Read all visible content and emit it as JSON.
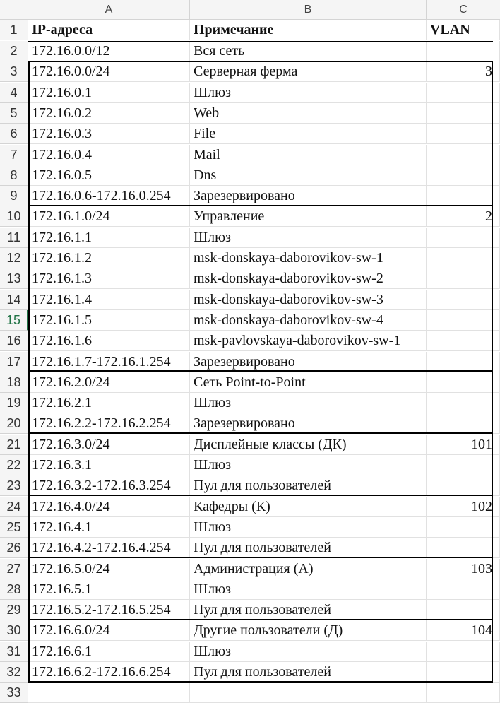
{
  "columns": [
    "A",
    "B",
    "C"
  ],
  "header": {
    "a": "IP-адреса",
    "b": "Примечание",
    "c": "VLAN"
  },
  "rows": [
    {
      "n": "2",
      "a": "172.16.0.0/12",
      "b": "Вся сеть",
      "c": ""
    },
    {
      "n": "3",
      "a": "172.16.0.0/24",
      "b": "Серверная ферма",
      "c": "3"
    },
    {
      "n": "4",
      "a": "172.16.0.1",
      "b": "Шлюз",
      "c": ""
    },
    {
      "n": "5",
      "a": "172.16.0.2",
      "b": "Web",
      "c": ""
    },
    {
      "n": "6",
      "a": "172.16.0.3",
      "b": "File",
      "c": ""
    },
    {
      "n": "7",
      "a": "172.16.0.4",
      "b": "Mail",
      "c": ""
    },
    {
      "n": "8",
      "a": "172.16.0.5",
      "b": "Dns",
      "c": ""
    },
    {
      "n": "9",
      "a": "172.16.0.6-172.16.0.254",
      "b": "Зарезервировано",
      "c": ""
    },
    {
      "n": "10",
      "a": "172.16.1.0/24",
      "b": "Управление",
      "c": "2"
    },
    {
      "n": "11",
      "a": "172.16.1.1",
      "b": "Шлюз",
      "c": ""
    },
    {
      "n": "12",
      "a": "172.16.1.2",
      "b": "msk-donskaya-daborovikov-sw-1",
      "c": ""
    },
    {
      "n": "13",
      "a": "172.16.1.3",
      "b": "msk-donskaya-daborovikov-sw-2",
      "c": ""
    },
    {
      "n": "14",
      "a": "172.16.1.4",
      "b": "msk-donskaya-daborovikov-sw-3",
      "c": ""
    },
    {
      "n": "15",
      "a": "172.16.1.5",
      "b": "msk-donskaya-daborovikov-sw-4",
      "c": ""
    },
    {
      "n": "16",
      "a": "172.16.1.6",
      "b": "msk-pavlovskaya-daborovikov-sw-1",
      "c": ""
    },
    {
      "n": "17",
      "a": "172.16.1.7-172.16.1.254",
      "b": "Зарезервировано",
      "c": ""
    },
    {
      "n": "18",
      "a": "172.16.2.0/24",
      "b": "Сеть Point-to-Point",
      "c": ""
    },
    {
      "n": "19",
      "a": "172.16.2.1",
      "b": "Шлюз",
      "c": ""
    },
    {
      "n": "20",
      "a": "172.16.2.2-172.16.2.254",
      "b": "Зарезервировано",
      "c": ""
    },
    {
      "n": "21",
      "a": "172.16.3.0/24",
      "b": "Дисплейные классы (ДК)",
      "c": "101"
    },
    {
      "n": "22",
      "a": "172.16.3.1",
      "b": "Шлюз",
      "c": ""
    },
    {
      "n": "23",
      "a": "172.16.3.2-172.16.3.254",
      "b": "Пул для пользователей",
      "c": ""
    },
    {
      "n": "24",
      "a": "172.16.4.0/24",
      "b": "Кафедры (К)",
      "c": "102"
    },
    {
      "n": "25",
      "a": "172.16.4.1",
      "b": "Шлюз",
      "c": ""
    },
    {
      "n": "26",
      "a": "172.16.4.2-172.16.4.254",
      "b": "Пул для пользователей",
      "c": ""
    },
    {
      "n": "27",
      "a": "172.16.5.0/24",
      "b": "Администрация (А)",
      "c": "103"
    },
    {
      "n": "28",
      "a": "172.16.5.1",
      "b": "Шлюз",
      "c": ""
    },
    {
      "n": "29",
      "a": "172.16.5.2-172.16.5.254",
      "b": "Пул для пользователей",
      "c": ""
    },
    {
      "n": "30",
      "a": "172.16.6.0/24",
      "b": "Другие пользователи (Д)",
      "c": "104"
    },
    {
      "n": "31",
      "a": "172.16.6.1",
      "b": "Шлюз",
      "c": ""
    },
    {
      "n": "32",
      "a": "172.16.6.2-172.16.6.254",
      "b": "Пул для пользователей",
      "c": ""
    },
    {
      "n": "33",
      "a": "",
      "b": "",
      "c": ""
    }
  ],
  "selected_row": "15",
  "colors": {
    "selection_accent": "#217346"
  }
}
